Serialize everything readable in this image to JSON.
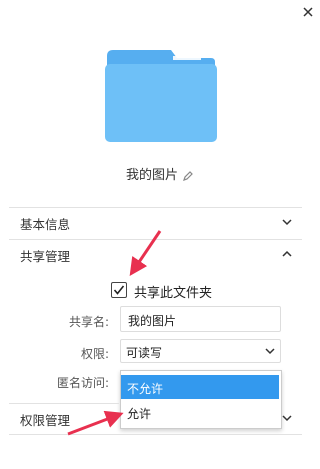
{
  "folder": {
    "name": "我的图片"
  },
  "icons": {
    "close": "close-icon",
    "folder": "folder-icon",
    "edit": "pencil-icon",
    "check": "check-icon",
    "chevron": "chevron-icon"
  },
  "sections": {
    "basic": {
      "title": "基本信息",
      "expanded": false
    },
    "share": {
      "title": "共享管理",
      "expanded": true
    },
    "permission": {
      "title": "权限管理",
      "expanded": false
    }
  },
  "share": {
    "checkbox_label": "共享此文件夹",
    "checked": true,
    "share_name_label": "共享名:",
    "share_name_value": "我的图片",
    "permission_label": "权限:",
    "permission_value": "可读写",
    "anonymous_label": "匿名访问:",
    "anonymous_options": [
      "不允许",
      "允许"
    ],
    "anonymous_highlighted": "不允许"
  },
  "colors": {
    "folder": "#6ec0f7",
    "folder_dark": "#56aef0",
    "highlight": "#3399ee",
    "annotation": "#e8304f"
  }
}
